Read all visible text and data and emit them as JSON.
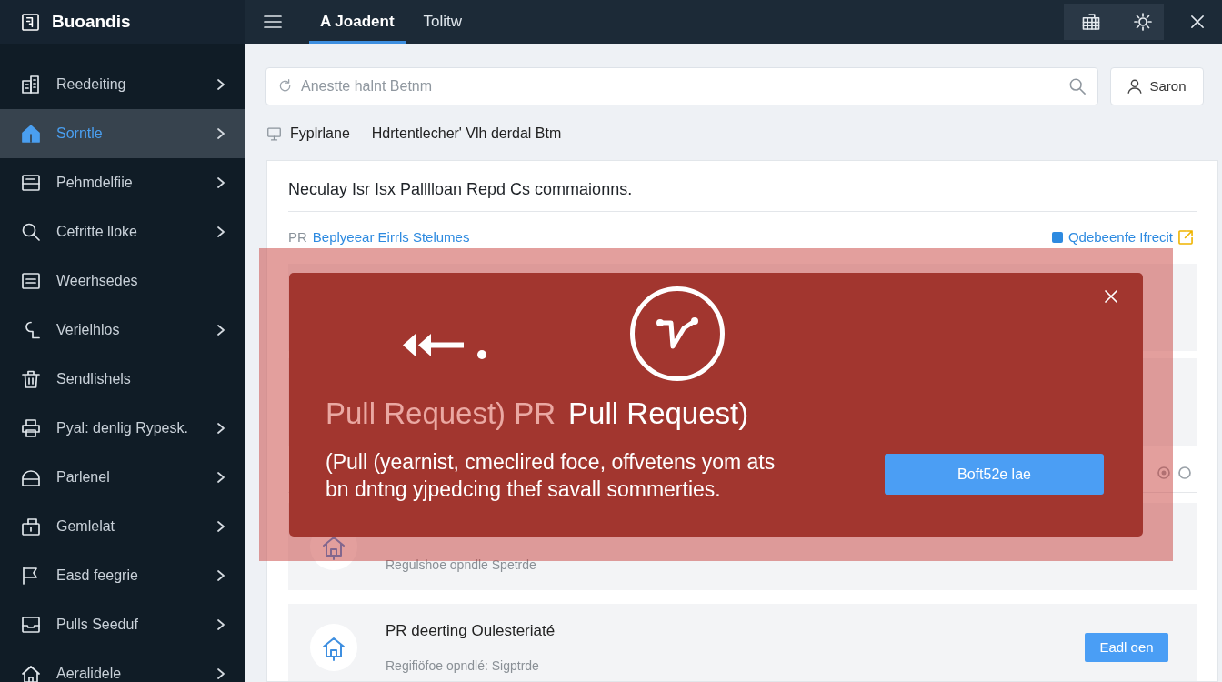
{
  "sidebar": {
    "title": "Buoandis",
    "items": [
      {
        "label": "Reedeiting",
        "selected": false,
        "arrow": true
      },
      {
        "label": "Sorntle",
        "selected": true,
        "arrow": true
      },
      {
        "label": "Pehmdelfiie",
        "selected": false,
        "arrow": true
      },
      {
        "label": "Cefritte lloke",
        "selected": false,
        "arrow": true
      },
      {
        "label": "Weerhsedes",
        "selected": false,
        "arrow": false
      },
      {
        "label": "Verielhlos",
        "selected": false,
        "arrow": true
      },
      {
        "label": "Sendlishels",
        "selected": false,
        "arrow": false
      },
      {
        "label": "Pyal: denlig Rypesk.",
        "selected": false,
        "arrow": true
      },
      {
        "label": "Parlenel",
        "selected": false,
        "arrow": true
      },
      {
        "label": "Gemlelat",
        "selected": false,
        "arrow": true
      },
      {
        "label": "Easd feegrie",
        "selected": false,
        "arrow": true
      },
      {
        "label": "Pulls Seeduf",
        "selected": false,
        "arrow": true
      },
      {
        "label": "Aeralidele",
        "selected": false,
        "arrow": true
      }
    ]
  },
  "tabs": [
    {
      "label": "A Joadent",
      "selected": true
    },
    {
      "label": "Tolitw",
      "selected": false
    }
  ],
  "search": {
    "placeholder": "Anestte halnt Betnm",
    "button": "Saron"
  },
  "breadcrumbs": [
    "Fyplrlane",
    "Hdrtentlecher' Vlh derdal Btm"
  ],
  "panel": {
    "heading": "Neculay Isr Isx Palllloan Repd Cs commaionns.",
    "filter_label": "PR",
    "filter_link": "Beplyeear Eirrls Stelumes",
    "action_link": "Qdebeenfe Ifrecit",
    "list": [
      {
        "kind": "blank"
      },
      {
        "kind": "blank"
      },
      {
        "kind": "options",
        "options": [
          {
            "selected": true
          },
          {
            "selected": false
          }
        ]
      },
      {
        "kind": "entry",
        "subtitle": "Regulshoe opndle Spetrde"
      },
      {
        "kind": "entry",
        "title": "PR deerting Oulesteriaté",
        "subtitle": "Regifiöfoe opndlé: Sigptrde",
        "button": "Eadl oen"
      }
    ]
  },
  "modal": {
    "title_prefix": "Pull Request) PR",
    "title": "Pull Request)",
    "body": "(Pull (yearnist, cmeclired foce, offvetens yom ats\nbn dntng yjpedcing thef savall sommerties.",
    "button": "Boft52e lae"
  }
}
